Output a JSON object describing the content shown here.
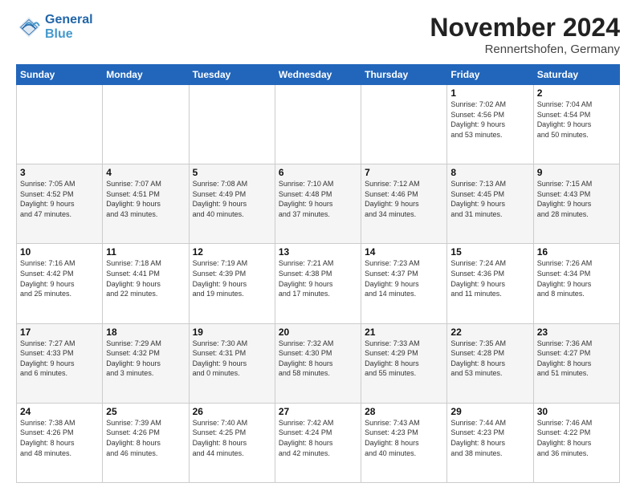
{
  "logo": {
    "line1": "General",
    "line2": "Blue"
  },
  "title": "November 2024",
  "location": "Rennertshofen, Germany",
  "weekdays": [
    "Sunday",
    "Monday",
    "Tuesday",
    "Wednesday",
    "Thursday",
    "Friday",
    "Saturday"
  ],
  "weeks": [
    [
      {
        "day": "",
        "info": ""
      },
      {
        "day": "",
        "info": ""
      },
      {
        "day": "",
        "info": ""
      },
      {
        "day": "",
        "info": ""
      },
      {
        "day": "",
        "info": ""
      },
      {
        "day": "1",
        "info": "Sunrise: 7:02 AM\nSunset: 4:56 PM\nDaylight: 9 hours\nand 53 minutes."
      },
      {
        "day": "2",
        "info": "Sunrise: 7:04 AM\nSunset: 4:54 PM\nDaylight: 9 hours\nand 50 minutes."
      }
    ],
    [
      {
        "day": "3",
        "info": "Sunrise: 7:05 AM\nSunset: 4:52 PM\nDaylight: 9 hours\nand 47 minutes."
      },
      {
        "day": "4",
        "info": "Sunrise: 7:07 AM\nSunset: 4:51 PM\nDaylight: 9 hours\nand 43 minutes."
      },
      {
        "day": "5",
        "info": "Sunrise: 7:08 AM\nSunset: 4:49 PM\nDaylight: 9 hours\nand 40 minutes."
      },
      {
        "day": "6",
        "info": "Sunrise: 7:10 AM\nSunset: 4:48 PM\nDaylight: 9 hours\nand 37 minutes."
      },
      {
        "day": "7",
        "info": "Sunrise: 7:12 AM\nSunset: 4:46 PM\nDaylight: 9 hours\nand 34 minutes."
      },
      {
        "day": "8",
        "info": "Sunrise: 7:13 AM\nSunset: 4:45 PM\nDaylight: 9 hours\nand 31 minutes."
      },
      {
        "day": "9",
        "info": "Sunrise: 7:15 AM\nSunset: 4:43 PM\nDaylight: 9 hours\nand 28 minutes."
      }
    ],
    [
      {
        "day": "10",
        "info": "Sunrise: 7:16 AM\nSunset: 4:42 PM\nDaylight: 9 hours\nand 25 minutes."
      },
      {
        "day": "11",
        "info": "Sunrise: 7:18 AM\nSunset: 4:41 PM\nDaylight: 9 hours\nand 22 minutes."
      },
      {
        "day": "12",
        "info": "Sunrise: 7:19 AM\nSunset: 4:39 PM\nDaylight: 9 hours\nand 19 minutes."
      },
      {
        "day": "13",
        "info": "Sunrise: 7:21 AM\nSunset: 4:38 PM\nDaylight: 9 hours\nand 17 minutes."
      },
      {
        "day": "14",
        "info": "Sunrise: 7:23 AM\nSunset: 4:37 PM\nDaylight: 9 hours\nand 14 minutes."
      },
      {
        "day": "15",
        "info": "Sunrise: 7:24 AM\nSunset: 4:36 PM\nDaylight: 9 hours\nand 11 minutes."
      },
      {
        "day": "16",
        "info": "Sunrise: 7:26 AM\nSunset: 4:34 PM\nDaylight: 9 hours\nand 8 minutes."
      }
    ],
    [
      {
        "day": "17",
        "info": "Sunrise: 7:27 AM\nSunset: 4:33 PM\nDaylight: 9 hours\nand 6 minutes."
      },
      {
        "day": "18",
        "info": "Sunrise: 7:29 AM\nSunset: 4:32 PM\nDaylight: 9 hours\nand 3 minutes."
      },
      {
        "day": "19",
        "info": "Sunrise: 7:30 AM\nSunset: 4:31 PM\nDaylight: 9 hours\nand 0 minutes."
      },
      {
        "day": "20",
        "info": "Sunrise: 7:32 AM\nSunset: 4:30 PM\nDaylight: 8 hours\nand 58 minutes."
      },
      {
        "day": "21",
        "info": "Sunrise: 7:33 AM\nSunset: 4:29 PM\nDaylight: 8 hours\nand 55 minutes."
      },
      {
        "day": "22",
        "info": "Sunrise: 7:35 AM\nSunset: 4:28 PM\nDaylight: 8 hours\nand 53 minutes."
      },
      {
        "day": "23",
        "info": "Sunrise: 7:36 AM\nSunset: 4:27 PM\nDaylight: 8 hours\nand 51 minutes."
      }
    ],
    [
      {
        "day": "24",
        "info": "Sunrise: 7:38 AM\nSunset: 4:26 PM\nDaylight: 8 hours\nand 48 minutes."
      },
      {
        "day": "25",
        "info": "Sunrise: 7:39 AM\nSunset: 4:26 PM\nDaylight: 8 hours\nand 46 minutes."
      },
      {
        "day": "26",
        "info": "Sunrise: 7:40 AM\nSunset: 4:25 PM\nDaylight: 8 hours\nand 44 minutes."
      },
      {
        "day": "27",
        "info": "Sunrise: 7:42 AM\nSunset: 4:24 PM\nDaylight: 8 hours\nand 42 minutes."
      },
      {
        "day": "28",
        "info": "Sunrise: 7:43 AM\nSunset: 4:23 PM\nDaylight: 8 hours\nand 40 minutes."
      },
      {
        "day": "29",
        "info": "Sunrise: 7:44 AM\nSunset: 4:23 PM\nDaylight: 8 hours\nand 38 minutes."
      },
      {
        "day": "30",
        "info": "Sunrise: 7:46 AM\nSunset: 4:22 PM\nDaylight: 8 hours\nand 36 minutes."
      }
    ]
  ]
}
